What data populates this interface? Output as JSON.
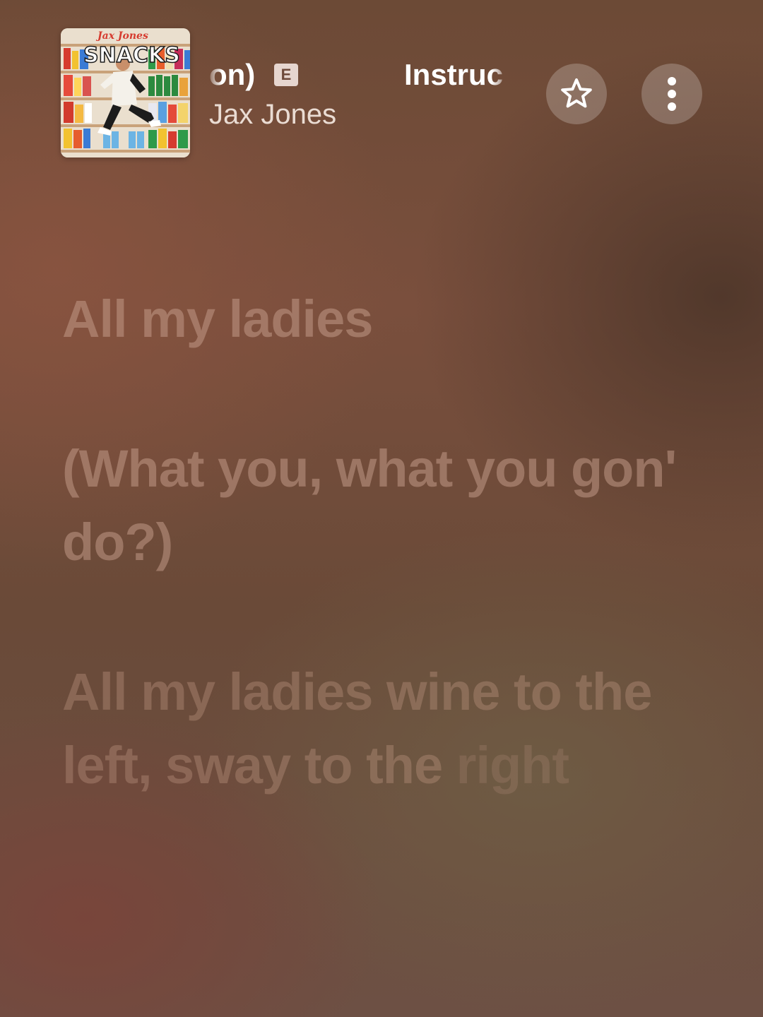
{
  "now_playing": {
    "artwork": {
      "artist_lettering": "Jax Jones",
      "album_lettering": "SNACKS"
    },
    "title_fragment_left": "on)",
    "explicit_badge": "E",
    "title_fragment_right": "Instruc",
    "artist": "Jax Jones"
  },
  "controls": {
    "favorite_icon": "star-outline-icon",
    "more_icon": "vertical-ellipsis-icon"
  },
  "lyrics": {
    "lines": [
      "All my ladies",
      "(What you, what you gon' do?)",
      "All my ladies wine to the left, sway to the"
    ],
    "last_line_tail": "right"
  },
  "colors": {
    "background": "#7a4f3d",
    "lyric_text": "#c8a08e",
    "button_bg": "rgba(255,255,255,0.22)"
  }
}
